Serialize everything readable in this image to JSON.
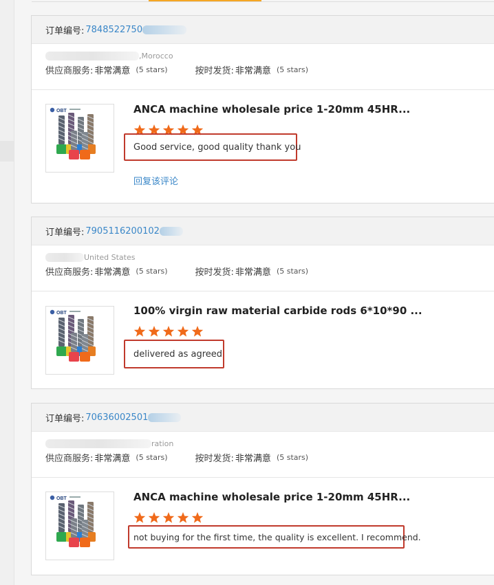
{
  "labels": {
    "order_no": "订单编号:",
    "supplier_service": "供应商服务:",
    "on_time_shipping": "按时发货:",
    "very_satisfied": "非常满意",
    "five_stars": "(5 stars)",
    "reply": "回复该评论"
  },
  "colors": {
    "accent": "#f5a623",
    "link": "#3a87c8",
    "star": "#f06a1a",
    "highlight_border": "#c0392b"
  },
  "orders": [
    {
      "order_number": "7848522750",
      "buyer_location": ",Morocco",
      "product_title": "ANCA machine wholesale price 1-20mm 45HR...",
      "rating": 5,
      "comment": "Good service, good quality thank you",
      "show_reply": true,
      "thumb_icon": "end-mill-cutters-product-icon"
    },
    {
      "order_number": "7905116200102",
      "buyer_location": "United States",
      "product_title": "100% virgin raw material carbide rods 6*10*90 ...",
      "rating": 5,
      "comment": "delivered as agreed",
      "show_reply": false,
      "thumb_icon": "end-mill-cutters-product-icon"
    },
    {
      "order_number": "70636002501",
      "buyer_location": "ration",
      "product_title": "ANCA machine wholesale price 1-20mm 45HR...",
      "rating": 5,
      "comment": "not buying for the first time, the quality is excellent. I recommend.",
      "show_reply": false,
      "thumb_icon": "end-mill-cutters-product-icon"
    }
  ]
}
